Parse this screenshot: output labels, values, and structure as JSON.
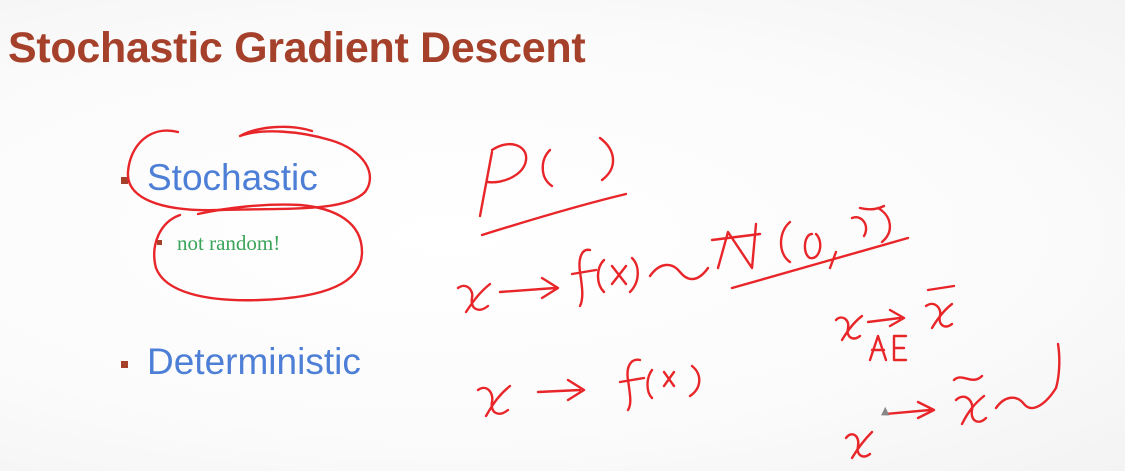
{
  "slide": {
    "title": "Stochastic Gradient Descent",
    "bullets": [
      {
        "label": "Stochastic",
        "sub_bullets": [
          "not random!"
        ]
      },
      {
        "label": "Deterministic",
        "sub_bullets": []
      }
    ]
  },
  "colors": {
    "title": "#a5402a",
    "bullet_text": "#4e7fd6",
    "sub_bullet_text": "#3aa55a",
    "bullet_marker": "#a5402a",
    "ink": "#e8262a"
  },
  "icons": {
    "bullet": "square-bullet-icon",
    "pointer": "mouse-pointer-icon"
  }
}
